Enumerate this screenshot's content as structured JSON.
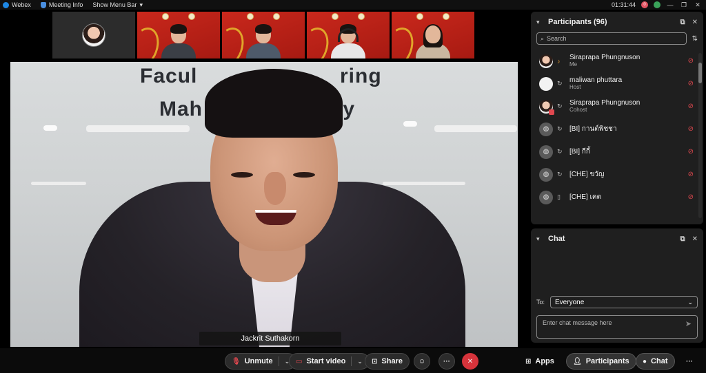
{
  "topbar": {
    "app_name": "Webex",
    "meeting_info": "Meeting Info",
    "show_menu_bar": "Show Menu Bar",
    "time": "01:31:44",
    "notif_badge": "0"
  },
  "filmstrip": {
    "tiles": [
      {
        "type": "self"
      },
      {
        "type": "remote"
      },
      {
        "type": "remote"
      },
      {
        "type": "remote"
      },
      {
        "type": "remote"
      }
    ]
  },
  "main_video": {
    "bg_text_line1_left": "Facul",
    "bg_text_line1_right": "ring",
    "bg_text_line2_left": "Mah",
    "bg_text_line2_right": "ity",
    "speaker_name": "Jackrit Suthakorn"
  },
  "participants_panel": {
    "title": "Participants (96)",
    "search_placeholder": "Search",
    "items": [
      {
        "name": "Siraprapa Phungnuson",
        "role": "Me",
        "avatar": "photo"
      },
      {
        "name": "maliwan phuttara",
        "role": "Host",
        "avatar": "white"
      },
      {
        "name": "Siraprapa Phungnuson",
        "role": "Cohost",
        "avatar": "photo"
      },
      {
        "name": "[BI] กานต์พิชชา",
        "role": "",
        "avatar": "generic"
      },
      {
        "name": "[BI] กีกี้",
        "role": "",
        "avatar": "generic"
      },
      {
        "name": "[CHE] ขวัญ",
        "role": "",
        "avatar": "generic"
      },
      {
        "name": "[CHE] เคต",
        "role": "",
        "avatar": "generic"
      }
    ]
  },
  "chat_panel": {
    "title": "Chat",
    "to_label": "To:",
    "to_value": "Everyone",
    "input_placeholder": "Enter chat message here"
  },
  "controls": {
    "unmute": "Unmute",
    "start_video": "Start video",
    "share": "Share",
    "more": "···",
    "apps": "Apps",
    "participants": "Participants",
    "chat": "Chat",
    "overflow": "···"
  },
  "colors": {
    "accent_red": "#d6333b",
    "panel_bg": "#1f1f1f",
    "muted_red": "#e0484f"
  }
}
